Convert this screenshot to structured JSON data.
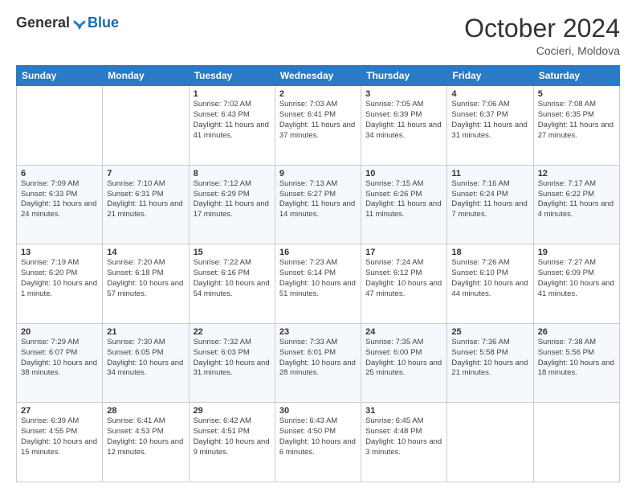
{
  "header": {
    "logo_general": "General",
    "logo_blue": "Blue",
    "month_title": "October 2024",
    "location": "Cocieri, Moldova"
  },
  "weekdays": [
    "Sunday",
    "Monday",
    "Tuesday",
    "Wednesday",
    "Thursday",
    "Friday",
    "Saturday"
  ],
  "weeks": [
    [
      {
        "day": "",
        "info": ""
      },
      {
        "day": "",
        "info": ""
      },
      {
        "day": "1",
        "sunrise": "7:02 AM",
        "sunset": "6:43 PM",
        "daylight": "11 hours and 41 minutes."
      },
      {
        "day": "2",
        "sunrise": "7:03 AM",
        "sunset": "6:41 PM",
        "daylight": "11 hours and 37 minutes."
      },
      {
        "day": "3",
        "sunrise": "7:05 AM",
        "sunset": "6:39 PM",
        "daylight": "11 hours and 34 minutes."
      },
      {
        "day": "4",
        "sunrise": "7:06 AM",
        "sunset": "6:37 PM",
        "daylight": "11 hours and 31 minutes."
      },
      {
        "day": "5",
        "sunrise": "7:08 AM",
        "sunset": "6:35 PM",
        "daylight": "11 hours and 27 minutes."
      }
    ],
    [
      {
        "day": "6",
        "sunrise": "7:09 AM",
        "sunset": "6:33 PM",
        "daylight": "11 hours and 24 minutes."
      },
      {
        "day": "7",
        "sunrise": "7:10 AM",
        "sunset": "6:31 PM",
        "daylight": "11 hours and 21 minutes."
      },
      {
        "day": "8",
        "sunrise": "7:12 AM",
        "sunset": "6:29 PM",
        "daylight": "11 hours and 17 minutes."
      },
      {
        "day": "9",
        "sunrise": "7:13 AM",
        "sunset": "6:27 PM",
        "daylight": "11 hours and 14 minutes."
      },
      {
        "day": "10",
        "sunrise": "7:15 AM",
        "sunset": "6:26 PM",
        "daylight": "11 hours and 11 minutes."
      },
      {
        "day": "11",
        "sunrise": "7:16 AM",
        "sunset": "6:24 PM",
        "daylight": "11 hours and 7 minutes."
      },
      {
        "day": "12",
        "sunrise": "7:17 AM",
        "sunset": "6:22 PM",
        "daylight": "11 hours and 4 minutes."
      }
    ],
    [
      {
        "day": "13",
        "sunrise": "7:19 AM",
        "sunset": "6:20 PM",
        "daylight": "10 hours and 1 minute."
      },
      {
        "day": "14",
        "sunrise": "7:20 AM",
        "sunset": "6:18 PM",
        "daylight": "10 hours and 57 minutes."
      },
      {
        "day": "15",
        "sunrise": "7:22 AM",
        "sunset": "6:16 PM",
        "daylight": "10 hours and 54 minutes."
      },
      {
        "day": "16",
        "sunrise": "7:23 AM",
        "sunset": "6:14 PM",
        "daylight": "10 hours and 51 minutes."
      },
      {
        "day": "17",
        "sunrise": "7:24 AM",
        "sunset": "6:12 PM",
        "daylight": "10 hours and 47 minutes."
      },
      {
        "day": "18",
        "sunrise": "7:26 AM",
        "sunset": "6:10 PM",
        "daylight": "10 hours and 44 minutes."
      },
      {
        "day": "19",
        "sunrise": "7:27 AM",
        "sunset": "6:09 PM",
        "daylight": "10 hours and 41 minutes."
      }
    ],
    [
      {
        "day": "20",
        "sunrise": "7:29 AM",
        "sunset": "6:07 PM",
        "daylight": "10 hours and 38 minutes."
      },
      {
        "day": "21",
        "sunrise": "7:30 AM",
        "sunset": "6:05 PM",
        "daylight": "10 hours and 34 minutes."
      },
      {
        "day": "22",
        "sunrise": "7:32 AM",
        "sunset": "6:03 PM",
        "daylight": "10 hours and 31 minutes."
      },
      {
        "day": "23",
        "sunrise": "7:33 AM",
        "sunset": "6:01 PM",
        "daylight": "10 hours and 28 minutes."
      },
      {
        "day": "24",
        "sunrise": "7:35 AM",
        "sunset": "6:00 PM",
        "daylight": "10 hours and 25 minutes."
      },
      {
        "day": "25",
        "sunrise": "7:36 AM",
        "sunset": "5:58 PM",
        "daylight": "10 hours and 21 minutes."
      },
      {
        "day": "26",
        "sunrise": "7:38 AM",
        "sunset": "5:56 PM",
        "daylight": "10 hours and 18 minutes."
      }
    ],
    [
      {
        "day": "27",
        "sunrise": "6:39 AM",
        "sunset": "4:55 PM",
        "daylight": "10 hours and 15 minutes."
      },
      {
        "day": "28",
        "sunrise": "6:41 AM",
        "sunset": "4:53 PM",
        "daylight": "10 hours and 12 minutes."
      },
      {
        "day": "29",
        "sunrise": "6:42 AM",
        "sunset": "4:51 PM",
        "daylight": "10 hours and 9 minutes."
      },
      {
        "day": "30",
        "sunrise": "6:43 AM",
        "sunset": "4:50 PM",
        "daylight": "10 hours and 6 minutes."
      },
      {
        "day": "31",
        "sunrise": "6:45 AM",
        "sunset": "4:48 PM",
        "daylight": "10 hours and 3 minutes."
      },
      {
        "day": "",
        "info": ""
      },
      {
        "day": "",
        "info": ""
      }
    ]
  ],
  "labels": {
    "sunrise": "Sunrise:",
    "sunset": "Sunset:",
    "daylight": "Daylight:"
  }
}
